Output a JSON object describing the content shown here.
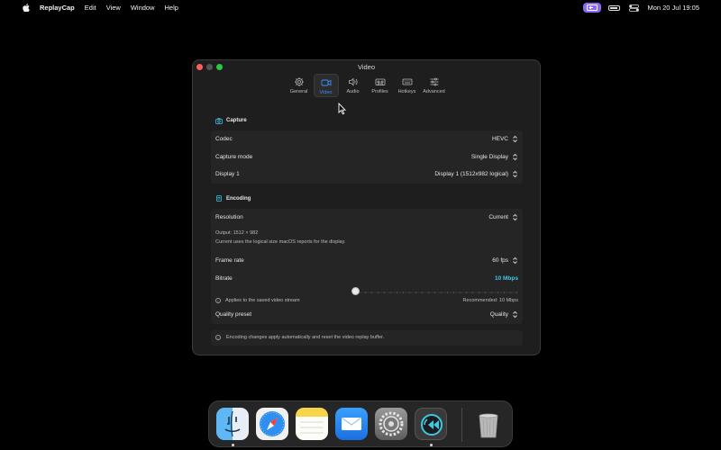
{
  "menubar": {
    "app_name": "ReplayCap",
    "menus": [
      "Edit",
      "View",
      "Window",
      "Help"
    ],
    "clock": "Mon 20 Jul  19:05"
  },
  "window": {
    "title": "Video",
    "tabs": [
      {
        "label": "General",
        "icon": "gear-icon"
      },
      {
        "label": "Video",
        "icon": "video-camera-icon",
        "active": true
      },
      {
        "label": "Audio",
        "icon": "speaker-icon"
      },
      {
        "label": "Profiles",
        "icon": "cassette-icon"
      },
      {
        "label": "Hotkeys",
        "icon": "keyboard-icon"
      },
      {
        "label": "Advanced",
        "icon": "sliders-icon"
      }
    ]
  },
  "capture": {
    "heading": "Capture",
    "codec_label": "Codec",
    "codec_value": "HEVC",
    "mode_label": "Capture mode",
    "mode_value": "Single Display",
    "display_label": "Display 1",
    "display_value": "Display 1 (1512x982 logical)"
  },
  "encoding": {
    "heading": "Encoding",
    "resolution_label": "Resolution",
    "resolution_value": "Current",
    "output_line": "Output: 1512 × 982",
    "output_note": "Current uses the logical size macOS reports for the display.",
    "framerate_label": "Frame rate",
    "framerate_value": "60 fps",
    "bitrate_label": "Bitrate",
    "bitrate_value": "10 Mbps",
    "bitrate_slider_fraction": 0.0,
    "bitrate_info": "Applies to the saved video stream",
    "bitrate_recommended": "Recommended: 10 Mbps",
    "quality_label": "Quality preset",
    "quality_value": "Quality"
  },
  "footer_note": "Encoding changes apply automatically and reset the video replay buffer.",
  "dock": {
    "apps": [
      "Finder",
      "Safari",
      "Notes",
      "Mail",
      "System Settings",
      "ReplayCap",
      "Trash"
    ]
  },
  "colors": {
    "accent": "#3b8cff",
    "bitrate": "#3ec8e6",
    "menubar_pill": "#8b6cf0"
  }
}
